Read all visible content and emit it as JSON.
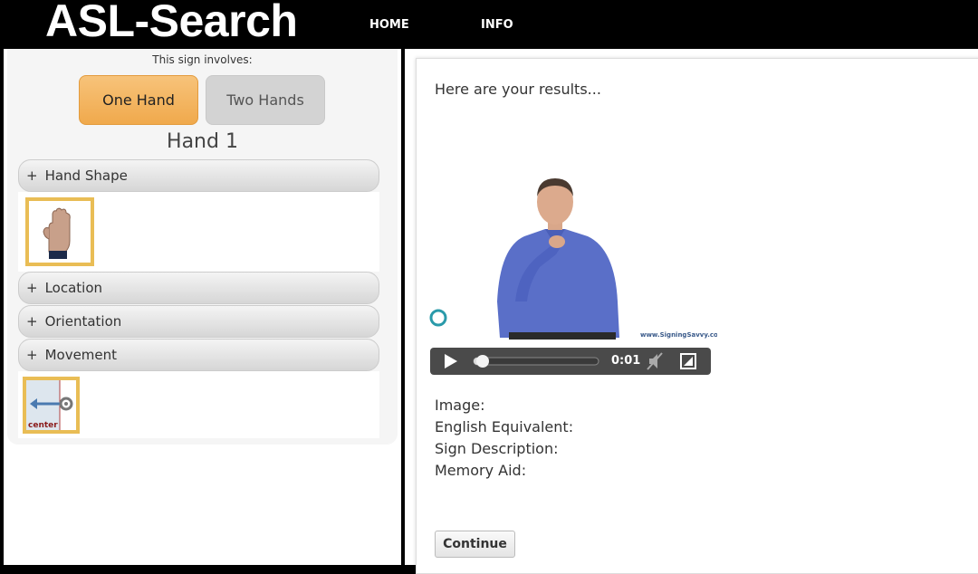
{
  "header": {
    "logo": "ASL-Search",
    "nav": [
      {
        "label": "HOME"
      },
      {
        "label": "INFO"
      }
    ]
  },
  "left": {
    "involves_label": "This sign involves:",
    "hand_buttons": [
      {
        "label": "One Hand",
        "selected": true
      },
      {
        "label": "Two Hands",
        "selected": false
      }
    ],
    "hand_title": "Hand 1",
    "accordions": [
      {
        "label": "Hand Shape",
        "icon": "plus-icon"
      },
      {
        "label": "Location",
        "icon": "plus-icon"
      },
      {
        "label": "Orientation",
        "icon": "plus-icon"
      },
      {
        "label": "Movement",
        "icon": "plus-icon"
      }
    ],
    "movement_thumb_label": "center"
  },
  "right": {
    "results_text": "Here are your results...",
    "video": {
      "time": "0:01",
      "progress": 0.05,
      "watermark": "www.SigningSavvy.com"
    },
    "info_labels": [
      "Image:",
      "English Equivalent:",
      "Sign Description:",
      "Memory Aid:"
    ],
    "continue_label": "Continue"
  },
  "colors": {
    "accent_orange": "#f0a94c",
    "thumb_border": "#e9bd55",
    "header_bg": "#000000"
  }
}
